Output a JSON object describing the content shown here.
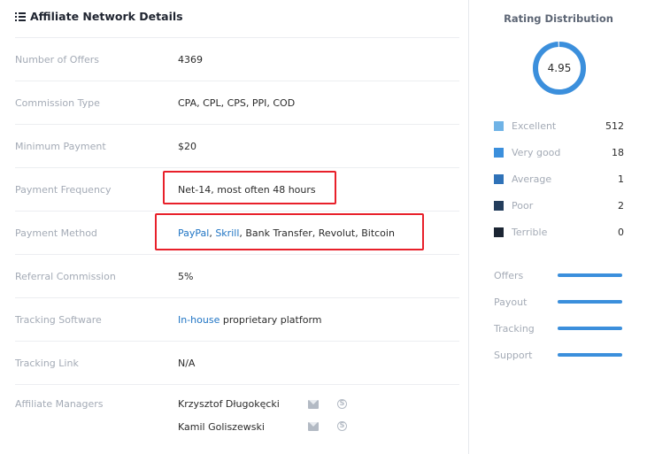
{
  "details": {
    "title": "Affiliate Network Details",
    "rows": [
      {
        "label": "Number of Offers",
        "value": "4369"
      },
      {
        "label": "Commission Type",
        "value": "CPA, CPL, CPS, PPI, COD"
      },
      {
        "label": "Minimum Payment",
        "value": "$20"
      },
      {
        "label": "Payment Frequency",
        "value": "Net-14, most often 48 hours"
      },
      {
        "label": "Payment Method",
        "links": [
          "PayPal",
          "Skrill"
        ],
        "sep1": ", ",
        "sep2": ", ",
        "rest": "Bank Transfer, Revolut, Bitcoin"
      },
      {
        "label": "Referral Commission",
        "value": "5%"
      },
      {
        "label": "Tracking Software",
        "link": "In-house",
        "rest": " proprietary platform"
      },
      {
        "label": "Tracking Link",
        "value": "N/A"
      }
    ],
    "managers": {
      "label": "Affiliate Managers",
      "names": [
        "Krzysztof Długokęcki",
        "Kamil Goliszewski"
      ],
      "skype_glyph": "S"
    }
  },
  "rating": {
    "title": "Rating Distribution",
    "score": "4.95",
    "score_fraction": 0.99,
    "distribution": [
      {
        "name": "Excellent",
        "count": "512",
        "color": "#6fb3e6"
      },
      {
        "name": "Very good",
        "count": "18",
        "color": "#3b8fdc"
      },
      {
        "name": "Average",
        "count": "1",
        "color": "#2f72b8"
      },
      {
        "name": "Poor",
        "count": "2",
        "color": "#233d5c"
      },
      {
        "name": "Terrible",
        "count": "0",
        "color": "#1b2533"
      }
    ],
    "bars": [
      {
        "name": "Offers",
        "fraction": 1.0
      },
      {
        "name": "Payout",
        "fraction": 1.0
      },
      {
        "name": "Tracking",
        "fraction": 1.0
      },
      {
        "name": "Support",
        "fraction": 1.0
      }
    ],
    "colors": {
      "ring": "#3b8fdc",
      "ring_bg": "#dfe6ee",
      "accent": "#1f74c4",
      "highlight": "#e8202a"
    }
  }
}
